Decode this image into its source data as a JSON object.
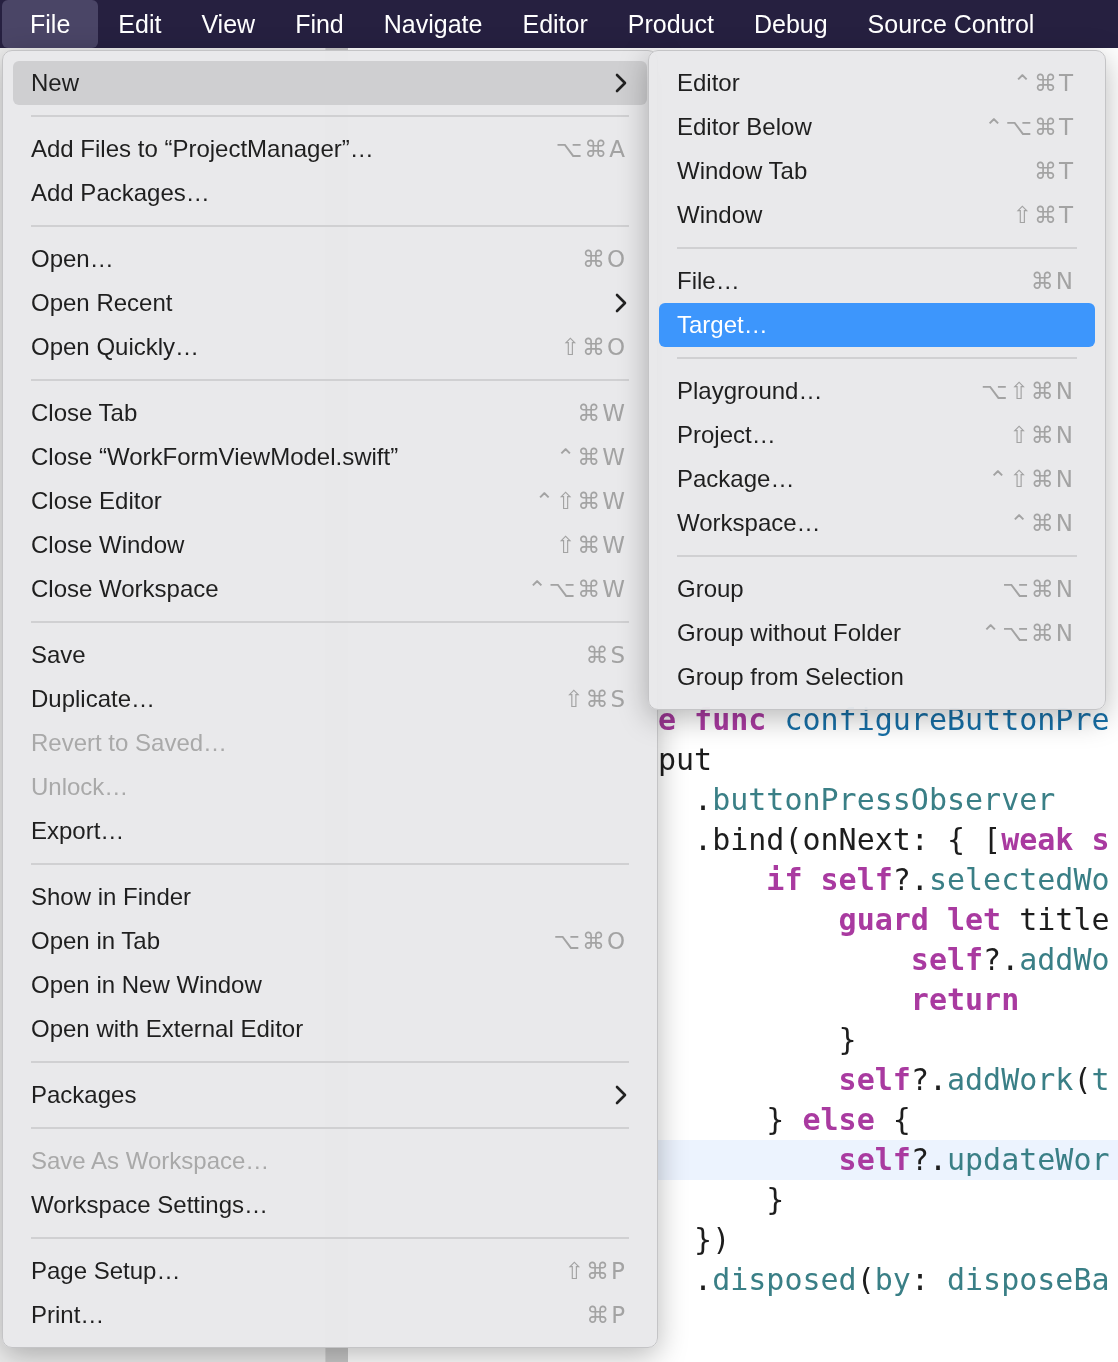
{
  "menu_bar": [
    {
      "label": "File",
      "selected": true
    },
    {
      "label": "Edit",
      "selected": false
    },
    {
      "label": "View",
      "selected": false
    },
    {
      "label": "Find",
      "selected": false
    },
    {
      "label": "Navigate",
      "selected": false
    },
    {
      "label": "Editor",
      "selected": false
    },
    {
      "label": "Product",
      "selected": false
    },
    {
      "label": "Debug",
      "selected": false
    },
    {
      "label": "Source Control",
      "selected": false
    }
  ],
  "file_menu": [
    {
      "kind": "item",
      "label": "New",
      "submenu": true,
      "disabled": false,
      "selected": true
    },
    {
      "kind": "separator"
    },
    {
      "kind": "item",
      "label": "Add Files to “ProjectManager”…",
      "shortcut": "⌥⌘A",
      "submenu": false,
      "disabled": false,
      "selected": false
    },
    {
      "kind": "item",
      "label": "Add Packages…",
      "submenu": false,
      "disabled": false,
      "selected": false
    },
    {
      "kind": "separator"
    },
    {
      "kind": "item",
      "label": "Open…",
      "shortcut": "⌘O",
      "submenu": false,
      "disabled": false,
      "selected": false
    },
    {
      "kind": "item",
      "label": "Open Recent",
      "submenu": true,
      "disabled": false,
      "selected": false
    },
    {
      "kind": "item",
      "label": "Open Quickly…",
      "shortcut": "⇧⌘O",
      "submenu": false,
      "disabled": false,
      "selected": false
    },
    {
      "kind": "separator"
    },
    {
      "kind": "item",
      "label": "Close Tab",
      "shortcut": "⌘W",
      "submenu": false,
      "disabled": false,
      "selected": false
    },
    {
      "kind": "item",
      "label": "Close “WorkFormViewModel.swift”",
      "shortcut": "⌃⌘W",
      "submenu": false,
      "disabled": false,
      "selected": false
    },
    {
      "kind": "item",
      "label": "Close Editor",
      "shortcut": "⌃⇧⌘W",
      "submenu": false,
      "disabled": false,
      "selected": false
    },
    {
      "kind": "item",
      "label": "Close Window",
      "shortcut": "⇧⌘W",
      "submenu": false,
      "disabled": false,
      "selected": false
    },
    {
      "kind": "item",
      "label": "Close Workspace",
      "shortcut": "⌃⌥⌘W",
      "submenu": false,
      "disabled": false,
      "selected": false
    },
    {
      "kind": "separator"
    },
    {
      "kind": "item",
      "label": "Save",
      "shortcut": "⌘S",
      "submenu": false,
      "disabled": false,
      "selected": false
    },
    {
      "kind": "item",
      "label": "Duplicate…",
      "shortcut": "⇧⌘S",
      "submenu": false,
      "disabled": false,
      "selected": false
    },
    {
      "kind": "item",
      "label": "Revert to Saved…",
      "submenu": false,
      "disabled": true,
      "selected": false
    },
    {
      "kind": "item",
      "label": "Unlock…",
      "submenu": false,
      "disabled": true,
      "selected": false
    },
    {
      "kind": "item",
      "label": "Export…",
      "submenu": false,
      "disabled": false,
      "selected": false
    },
    {
      "kind": "separator"
    },
    {
      "kind": "item",
      "label": "Show in Finder",
      "submenu": false,
      "disabled": false,
      "selected": false
    },
    {
      "kind": "item",
      "label": "Open in Tab",
      "shortcut": "⌥⌘O",
      "submenu": false,
      "disabled": false,
      "selected": false
    },
    {
      "kind": "item",
      "label": "Open in New Window",
      "submenu": false,
      "disabled": false,
      "selected": false
    },
    {
      "kind": "item",
      "label": "Open with External Editor",
      "submenu": false,
      "disabled": false,
      "selected": false
    },
    {
      "kind": "separator"
    },
    {
      "kind": "item",
      "label": "Packages",
      "submenu": true,
      "disabled": false,
      "selected": false
    },
    {
      "kind": "separator"
    },
    {
      "kind": "item",
      "label": "Save As Workspace…",
      "submenu": false,
      "disabled": true,
      "selected": false
    },
    {
      "kind": "item",
      "label": "Workspace Settings…",
      "submenu": false,
      "disabled": false,
      "selected": false
    },
    {
      "kind": "separator"
    },
    {
      "kind": "item",
      "label": "Page Setup…",
      "shortcut": "⇧⌘P",
      "submenu": false,
      "disabled": false,
      "selected": false
    },
    {
      "kind": "item",
      "label": "Print…",
      "shortcut": "⌘P",
      "submenu": false,
      "disabled": false,
      "selected": false
    }
  ],
  "new_submenu": [
    {
      "kind": "item",
      "label": "Editor",
      "shortcut": "⌃⌘T",
      "submenu": false,
      "disabled": false,
      "selected": false
    },
    {
      "kind": "item",
      "label": "Editor Below",
      "shortcut": "⌃⌥⌘T",
      "submenu": false,
      "disabled": false,
      "selected": false
    },
    {
      "kind": "item",
      "label": "Window Tab",
      "shortcut": "⌘T",
      "submenu": false,
      "disabled": false,
      "selected": false
    },
    {
      "kind": "item",
      "label": "Window",
      "shortcut": "⇧⌘T",
      "submenu": false,
      "disabled": false,
      "selected": false
    },
    {
      "kind": "separator"
    },
    {
      "kind": "item",
      "label": "File…",
      "shortcut": "⌘N",
      "submenu": false,
      "disabled": false,
      "selected": false
    },
    {
      "kind": "item",
      "label": "Target…",
      "submenu": false,
      "disabled": false,
      "selected": true
    },
    {
      "kind": "separator"
    },
    {
      "kind": "item",
      "label": "Playground…",
      "shortcut": "⌥⇧⌘N",
      "submenu": false,
      "disabled": false,
      "selected": false
    },
    {
      "kind": "item",
      "label": "Project…",
      "shortcut": "⇧⌘N",
      "submenu": false,
      "disabled": false,
      "selected": false
    },
    {
      "kind": "item",
      "label": "Package…",
      "shortcut": "⌃⇧⌘N",
      "submenu": false,
      "disabled": false,
      "selected": false
    },
    {
      "kind": "item",
      "label": "Workspace…",
      "shortcut": "⌃⌘N",
      "submenu": false,
      "disabled": false,
      "selected": false
    },
    {
      "kind": "separator"
    },
    {
      "kind": "item",
      "label": "Group",
      "shortcut": "⌥⌘N",
      "submenu": false,
      "disabled": false,
      "selected": false
    },
    {
      "kind": "item",
      "label": "Group without Folder",
      "shortcut": "⌃⌥⌘N",
      "submenu": false,
      "disabled": false,
      "selected": false
    },
    {
      "kind": "item",
      "label": "Group from Selection",
      "submenu": false,
      "disabled": false,
      "selected": false
    }
  ],
  "code_lines": [
    {
      "highlighted": false,
      "tokens": [
        {
          "kind": "keyword",
          "text": "e func"
        },
        {
          "kind": "function",
          "text": " configureButtonPre"
        }
      ]
    },
    {
      "highlighted": false,
      "tokens": [
        {
          "kind": "plain",
          "text": "put"
        }
      ]
    },
    {
      "highlighted": false,
      "tokens": [
        {
          "kind": "plain",
          "text": "  ."
        },
        {
          "kind": "member",
          "text": "buttonPressObserver"
        }
      ]
    },
    {
      "highlighted": false,
      "tokens": [
        {
          "kind": "plain",
          "text": "  .bind(onNext: { ["
        },
        {
          "kind": "keyword",
          "text": "weak s"
        }
      ]
    },
    {
      "highlighted": false,
      "tokens": [
        {
          "kind": "keyword",
          "text": "      if self"
        },
        {
          "kind": "plain",
          "text": "?."
        },
        {
          "kind": "member",
          "text": "selectedWo"
        }
      ]
    },
    {
      "highlighted": false,
      "tokens": [
        {
          "kind": "keyword",
          "text": "          guard let"
        },
        {
          "kind": "plain",
          "text": " title"
        }
      ]
    },
    {
      "highlighted": false,
      "tokens": [
        {
          "kind": "keyword",
          "text": "              self"
        },
        {
          "kind": "plain",
          "text": "?."
        },
        {
          "kind": "member",
          "text": "addWo"
        }
      ]
    },
    {
      "highlighted": false,
      "tokens": [
        {
          "kind": "keyword",
          "text": "              return"
        }
      ]
    },
    {
      "highlighted": false,
      "tokens": [
        {
          "kind": "plain",
          "text": "          }"
        }
      ]
    },
    {
      "highlighted": false,
      "tokens": [
        {
          "kind": "keyword",
          "text": "          self"
        },
        {
          "kind": "plain",
          "text": "?."
        },
        {
          "kind": "member",
          "text": "addWork"
        },
        {
          "kind": "plain",
          "text": "("
        },
        {
          "kind": "member",
          "text": "t"
        }
      ]
    },
    {
      "highlighted": false,
      "tokens": [
        {
          "kind": "plain",
          "text": "      } "
        },
        {
          "kind": "keyword",
          "text": "else"
        },
        {
          "kind": "plain",
          "text": " {"
        }
      ]
    },
    {
      "highlighted": true,
      "tokens": [
        {
          "kind": "keyword",
          "text": "          self"
        },
        {
          "kind": "plain",
          "text": "?."
        },
        {
          "kind": "member",
          "text": "updateWor"
        }
      ]
    },
    {
      "highlighted": false,
      "tokens": [
        {
          "kind": "plain",
          "text": "      }"
        }
      ]
    },
    {
      "highlighted": false,
      "tokens": [
        {
          "kind": "plain",
          "text": "  })"
        }
      ]
    },
    {
      "highlighted": false,
      "tokens": [
        {
          "kind": "plain",
          "text": "  ."
        },
        {
          "kind": "member",
          "text": "disposed"
        },
        {
          "kind": "plain",
          "text": "("
        },
        {
          "kind": "member",
          "text": "by"
        },
        {
          "kind": "plain",
          "text": ": "
        },
        {
          "kind": "member",
          "text": "disposeBa"
        }
      ]
    }
  ]
}
